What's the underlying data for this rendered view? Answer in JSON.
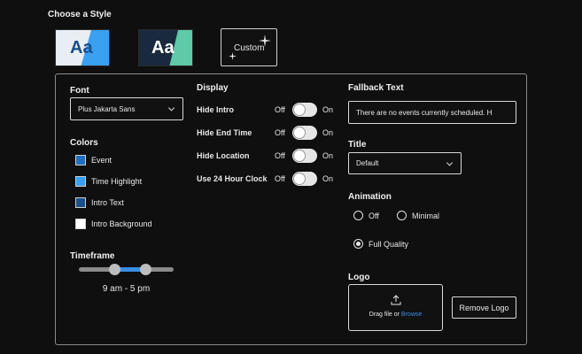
{
  "header": {
    "choose_style": "Choose a Style"
  },
  "styles": {
    "thumb1_text": "Aa",
    "thumb2_text": "Aa",
    "custom_label": "Custom"
  },
  "font": {
    "label": "Font",
    "value": "Plus Jakarta Sans"
  },
  "colors": {
    "label": "Colors",
    "items": [
      {
        "label": "Event",
        "color": "#1f6fbd"
      },
      {
        "label": "Time Highlight",
        "color": "#3aa0f0"
      },
      {
        "label": "Intro Text",
        "color": "#1b4f8a"
      },
      {
        "label": "Intro Background",
        "color": "#ffffff"
      }
    ]
  },
  "timeframe": {
    "label": "Timeframe",
    "value": "9 am - 5 pm",
    "range_start": 0.37,
    "range_end": 0.7
  },
  "display": {
    "label": "Display",
    "off_label": "Off",
    "on_label": "On",
    "rows": [
      {
        "label": "Hide Intro",
        "on": false
      },
      {
        "label": "Hide End Time",
        "on": false
      },
      {
        "label": "Hide Location",
        "on": false
      },
      {
        "label": "Use 24 Hour Clock",
        "on": false
      }
    ]
  },
  "fallback": {
    "label": "Fallback Text",
    "value": "There are no events currently scheduled. H"
  },
  "title": {
    "label": "Title",
    "value": "Default"
  },
  "animation": {
    "label": "Animation",
    "options": [
      {
        "label": "Off",
        "selected": false
      },
      {
        "label": "Minimal",
        "selected": false
      },
      {
        "label": "Full Quality",
        "selected": true
      }
    ]
  },
  "logo": {
    "label": "Logo",
    "drag_text": "Drag file or",
    "browse_text": "Browse",
    "remove_label": "Remove Logo"
  },
  "accent": "#3a8ee6"
}
